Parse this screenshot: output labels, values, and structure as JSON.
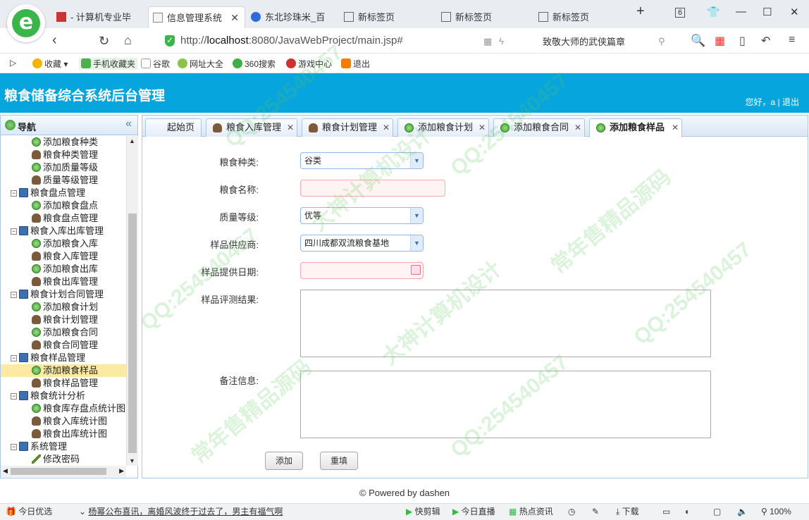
{
  "browser": {
    "tabs": [
      {
        "title": "- 计算机专业毕"
      },
      {
        "title": "信息管理系统"
      },
      {
        "title": "东北珍珠米_百"
      },
      {
        "title": "新标签页"
      },
      {
        "title": "新标签页"
      },
      {
        "title": "新标签页"
      }
    ],
    "tab_count": "6",
    "url_prefix": "http://",
    "url_host": "localhost",
    "url_rest": ":8080/JavaWebProject/main.jsp#",
    "search_text": "致敬大师的武侠篇章",
    "bookmarks": [
      "收藏",
      "手机收藏夹",
      "谷歌",
      "网址大全",
      "360搜索",
      "游戏中心",
      "退出"
    ]
  },
  "app": {
    "title": "粮食储备综合系统后台管理",
    "user_greeting": "您好，a",
    "logout": "退出",
    "nav_title": "导航"
  },
  "tree": [
    {
      "label": "添加粮食种类",
      "level": 2,
      "icon": "add-icon"
    },
    {
      "label": "粮食种类管理",
      "level": 2,
      "icon": "user-icon"
    },
    {
      "label": "添加质量等级",
      "level": 2,
      "icon": "add-icon"
    },
    {
      "label": "质量等级管理",
      "level": 2,
      "icon": "user-icon"
    },
    {
      "label": "粮食盘点管理",
      "level": 1,
      "icon": "computer-icon"
    },
    {
      "label": "添加粮食盘点",
      "level": 2,
      "icon": "add-icon"
    },
    {
      "label": "粮食盘点管理",
      "level": 2,
      "icon": "user-icon"
    },
    {
      "label": "粮食入库出库管理",
      "level": 1,
      "icon": "computer-icon"
    },
    {
      "label": "添加粮食入库",
      "level": 2,
      "icon": "add-icon"
    },
    {
      "label": "粮食入库管理",
      "level": 2,
      "icon": "user-icon"
    },
    {
      "label": "添加粮食出库",
      "level": 2,
      "icon": "add-icon"
    },
    {
      "label": "粮食出库管理",
      "level": 2,
      "icon": "user-icon"
    },
    {
      "label": "粮食计划合同管理",
      "level": 1,
      "icon": "computer-icon"
    },
    {
      "label": "添加粮食计划",
      "level": 2,
      "icon": "add-icon"
    },
    {
      "label": "粮食计划管理",
      "level": 2,
      "icon": "user-icon"
    },
    {
      "label": "添加粮食合同",
      "level": 2,
      "icon": "add-icon"
    },
    {
      "label": "粮食合同管理",
      "level": 2,
      "icon": "user-icon"
    },
    {
      "label": "粮食样品管理",
      "level": 1,
      "icon": "computer-icon"
    },
    {
      "label": "添加粮食样品",
      "level": 2,
      "icon": "add-icon",
      "selected": true
    },
    {
      "label": "粮食样品管理",
      "level": 2,
      "icon": "user-icon"
    },
    {
      "label": "粮食统计分析",
      "level": 1,
      "icon": "computer-icon"
    },
    {
      "label": "粮食库存盘点统计图",
      "level": 2,
      "icon": "add-icon"
    },
    {
      "label": "粮食入库统计图",
      "level": 2,
      "icon": "user-icon"
    },
    {
      "label": "粮食出库统计图",
      "level": 2,
      "icon": "user-icon"
    },
    {
      "label": "系统管理",
      "level": 1,
      "icon": "computer-icon"
    },
    {
      "label": "修改密码",
      "level": 2,
      "icon": "pencil-icon"
    }
  ],
  "main_tabs": [
    {
      "label": "起始页"
    },
    {
      "label": "粮食入库管理"
    },
    {
      "label": "粮食计划管理"
    },
    {
      "label": "添加粮食计划"
    },
    {
      "label": "添加粮食合同"
    },
    {
      "label": "添加粮食样品"
    }
  ],
  "form": {
    "grain_type_label": "粮食种类:",
    "grain_type_value": "谷类",
    "grain_name_label": "粮食名称:",
    "grain_name_value": "",
    "quality_label": "质量等级:",
    "quality_value": "优等",
    "supplier_label": "样品供应商:",
    "supplier_value": "四川成都双流粮食基地",
    "date_label": "样品提供日期:",
    "date_value": "",
    "eval_label": "样品评测结果:",
    "remark_label": "备注信息:",
    "add_button": "添加",
    "reset_button": "重填"
  },
  "footer": "© Powered by dashen",
  "statusbar": {
    "left": "今日优选",
    "news": "杨幂公布喜讯，离婚风波终于过去了，男主有福气啊",
    "items": [
      "快剪辑",
      "今日直播",
      "热点资讯",
      "下载"
    ],
    "zoom": "100%"
  },
  "watermark": [
    "QQ:254540457",
    "大神计算机设计",
    "常年售精品源码"
  ],
  "colors": {
    "header": "#07a5dd",
    "selected_row": "#fbe9a4",
    "required_field": "#fff3f3"
  }
}
